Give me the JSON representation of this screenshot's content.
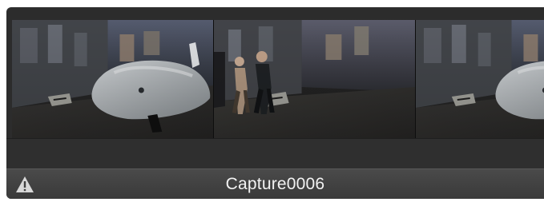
{
  "clip": {
    "title": "Capture0006",
    "status_icon": "warning-icon",
    "accent_colors": {
      "background": "#2c2c2c",
      "title_bar": "#3f3f3f",
      "text": "#f2f2f2"
    }
  },
  "filmstrip": {
    "frames": [
      {
        "kind": "thumbnail-1",
        "subject": "scooter-on-street"
      },
      {
        "kind": "thumbnail-2",
        "subject": "pedestrians-walking"
      },
      {
        "kind": "thumbnail-3",
        "subject": "scooter-on-street"
      }
    ]
  }
}
